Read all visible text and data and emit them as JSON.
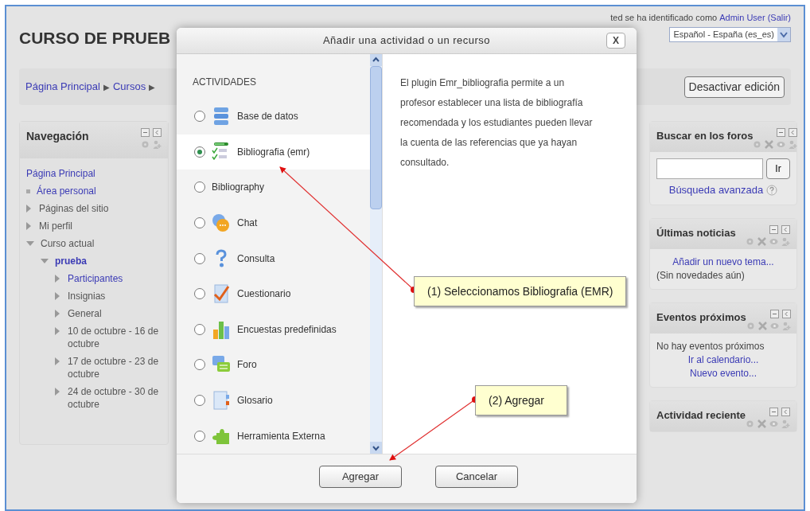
{
  "page": {
    "title": "CURSO DE PRUEB",
    "login": {
      "text": "ted se ha identificado como",
      "user": "Admin User",
      "logout": "(Salir)"
    },
    "language": "Español - España (es_es)"
  },
  "breadcrumb": {
    "items": [
      "Página Principal",
      "Cursos"
    ],
    "separator": "▶"
  },
  "edit_button": "Desactivar edición",
  "navigation": {
    "title": "Navegación",
    "items": [
      {
        "label": "Página Principal",
        "kind": "root",
        "link": true
      },
      {
        "label": "Área personal",
        "kind": "leaf",
        "link": true
      },
      {
        "label": "Páginas del sitio",
        "kind": "branch",
        "expanded": false,
        "link": false
      },
      {
        "label": "Mi perfil",
        "kind": "branch",
        "expanded": false,
        "link": false
      },
      {
        "label": "Curso actual",
        "kind": "branch",
        "expanded": true,
        "link": false,
        "children": [
          {
            "label": "prueba",
            "kind": "branch",
            "expanded": true,
            "link": true,
            "bold": true,
            "children": [
              {
                "label": "Participantes",
                "kind": "branch",
                "expanded": false,
                "link": true
              },
              {
                "label": "Insignias",
                "kind": "branch",
                "expanded": false,
                "link": false
              },
              {
                "label": "General",
                "kind": "branch",
                "expanded": false,
                "link": false
              },
              {
                "label": "10 de octubre - 16 de octubre",
                "kind": "branch",
                "expanded": false,
                "link": false
              },
              {
                "label": "17 de octubre - 23 de octubre",
                "kind": "branch",
                "expanded": false,
                "link": false
              },
              {
                "label": "24 de octubre - 30 de octubre",
                "kind": "branch",
                "expanded": false,
                "link": false
              }
            ]
          }
        ]
      }
    ]
  },
  "blocks": [
    {
      "title": "Buscar en los foros",
      "kind": "search",
      "button": "Ir",
      "link": "Búsqueda avanzada"
    },
    {
      "title": "Últimas noticias",
      "kind": "lines",
      "lines": [
        {
          "text": "Añadir un nuevo tema...",
          "link": true
        },
        {
          "text": "(Sin novedades aún)",
          "link": false
        }
      ]
    },
    {
      "title": "Eventos próximos",
      "kind": "lines",
      "lines": [
        {
          "text": "No hay eventos próximos",
          "link": false
        },
        {
          "text": "Ir al calendario...",
          "link": true
        },
        {
          "text": "Nuevo evento...",
          "link": true
        }
      ]
    },
    {
      "title": "Actividad reciente",
      "kind": "header"
    }
  ],
  "dialog": {
    "title": "Añadir una actividad o un recurso",
    "close": "X",
    "section": "ACTIVIDADES",
    "options": [
      {
        "label": "Base de datos",
        "selected": false
      },
      {
        "label": "Bibliografia (emr)",
        "selected": true
      },
      {
        "label": "Bibliography",
        "selected": false
      },
      {
        "label": "Chat",
        "selected": false
      },
      {
        "label": "Consulta",
        "selected": false
      },
      {
        "label": "Cuestionario",
        "selected": false
      },
      {
        "label": "Encuestas predefinidas",
        "selected": false
      },
      {
        "label": "Foro",
        "selected": false
      },
      {
        "label": "Glosario",
        "selected": false
      },
      {
        "label": "Herramienta Externa",
        "selected": false
      }
    ],
    "description": "El plugin Emr_bibliografia permite a un profesor establecer una lista de bibliografía recomendada y los estudiantes pueden llevar la cuenta de las referencias que ya hayan consultado.",
    "buttons": [
      "Agregar",
      "Cancelar"
    ]
  },
  "callouts": [
    "(1) Seleccionamos Bibliografia (EMR)",
    "(2) Agregar"
  ]
}
